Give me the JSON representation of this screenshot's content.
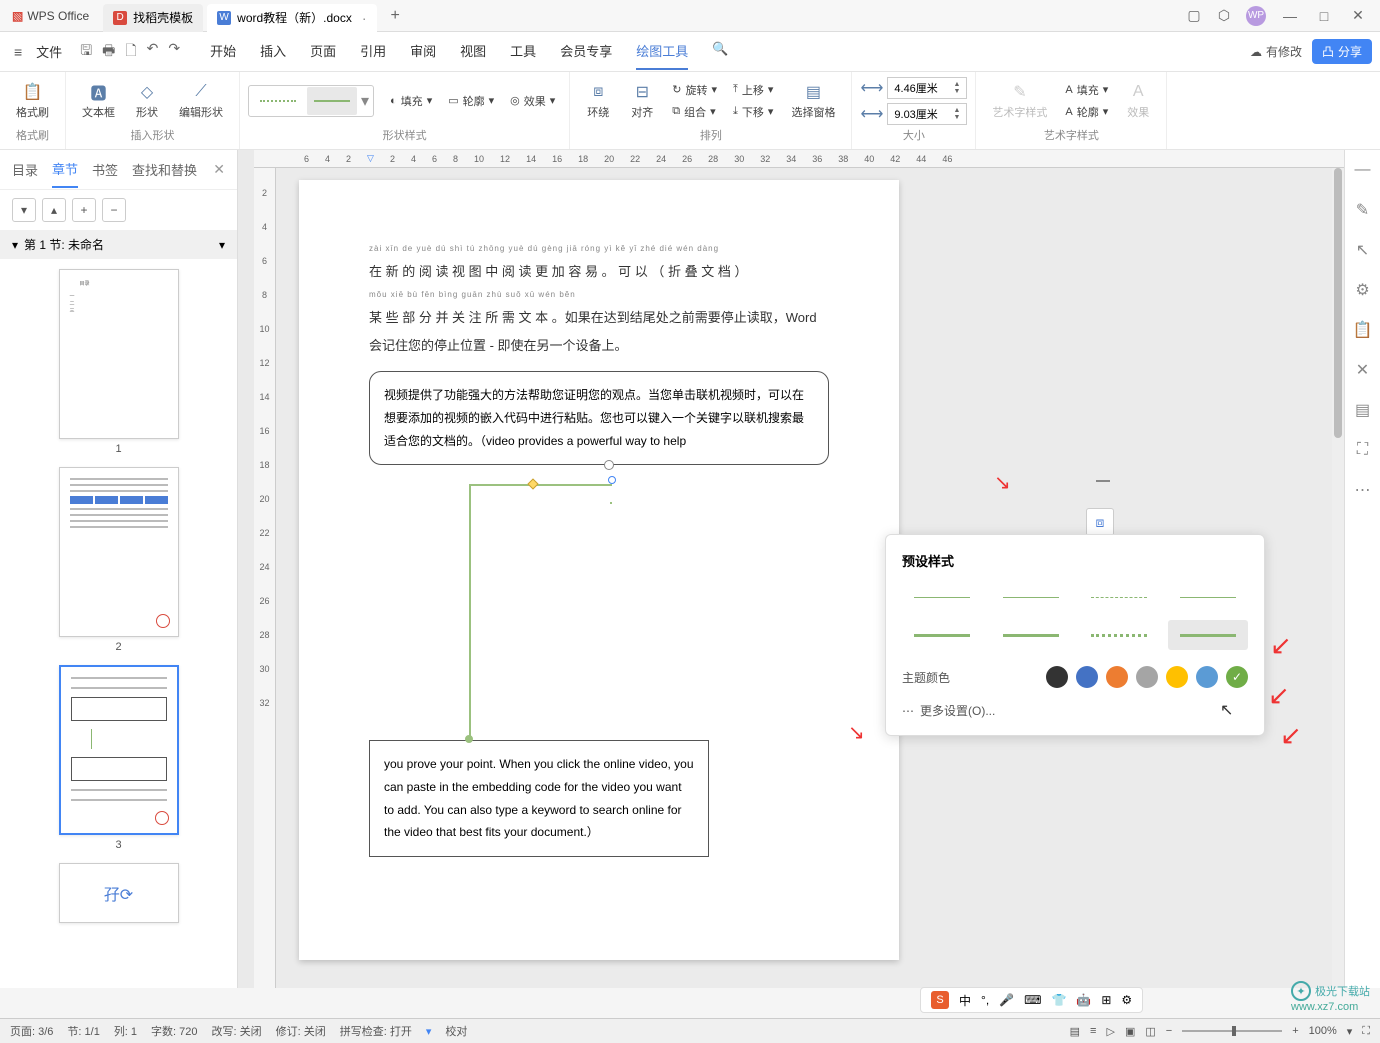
{
  "titlebar": {
    "app_name": "WPS Office",
    "tabs": [
      {
        "icon": "D",
        "label": "找稻壳模板"
      },
      {
        "icon": "W",
        "label": "word教程（新）.docx"
      }
    ],
    "avatar": "WP"
  },
  "menubar": {
    "file": "文件",
    "tabs": [
      "开始",
      "插入",
      "页面",
      "引用",
      "审阅",
      "视图",
      "工具",
      "会员专享",
      "绘图工具"
    ],
    "active": "绘图工具",
    "edit_status": "有修改",
    "share": "分享"
  },
  "ribbon": {
    "format_painter": "格式刷",
    "group_format": "格式刷",
    "textbox": "文本框",
    "shape": "形状",
    "edit_shape": "编辑形状",
    "group_insert": "插入形状",
    "fill": "填充",
    "outline": "轮廓",
    "effect": "效果",
    "group_style": "形状样式",
    "wrap": "环绕",
    "align": "对齐",
    "rotate": "旋转",
    "group": "组合",
    "move_up": "上移",
    "move_down": "下移",
    "select_pane": "选择窗格",
    "group_arrange": "排列",
    "width": "4.46厘米",
    "height": "9.03厘米",
    "group_size": "大小",
    "art_style": "艺术字样式",
    "art_fill": "填充",
    "art_outline": "轮廓",
    "art_effect": "效果",
    "group_art": "艺术字样式"
  },
  "left_panel": {
    "tabs": [
      "目录",
      "章节",
      "书签",
      "查找和替换"
    ],
    "active": "章节",
    "section": "第 1 节: 未命名",
    "thumb_labels": [
      "1",
      "2",
      "3"
    ]
  },
  "ruler_h": [
    "6",
    "4",
    "2",
    "",
    "2",
    "4",
    "6",
    "8",
    "10",
    "12",
    "14",
    "16",
    "18",
    "20",
    "22",
    "24",
    "26",
    "28",
    "30",
    "32",
    "34",
    "36",
    "38",
    "40",
    "42",
    "44",
    "46"
  ],
  "ruler_v": [
    "2",
    "4",
    "6",
    "8",
    "10",
    "12",
    "14",
    "16",
    "18",
    "20",
    "22",
    "24",
    "26",
    "28",
    "30",
    "32"
  ],
  "doc": {
    "pinyin": "zài xīn de yuè dú shì tú zhōng yuè dú gèng jiā róng yì     kě yǐ     zhé dié wén dàng",
    "line1": "在 新 的 阅 读 视 图 中 阅 读 更 加 容 易 。 可 以 （ 折 叠 文 档 ）",
    "pinyin2": "mǒu xiē bù fēn bìng guān zhù suǒ xū wén běn",
    "line2": "某 些 部 分 并 关 注 所 需 文 本 。如果在达到结尾处之前需要停止读取，Word",
    "line3": "会记住您的停止位置 - 即使在另一个设备上。",
    "box1": "视频提供了功能强大的方法帮助您证明您的观点。当您单击联机视频时，可以在想要添加的视频的嵌入代码中进行粘贴。您也可以键入一个关键字以联机搜索最适合您的文档的。（video provides a powerful way to help",
    "box2": "you prove your point. When you click the online video, you can paste in the embedding code for the video you want to add. You can also type a keyword to search online for the video that best fits your document.）"
  },
  "popup": {
    "title": "预设样式",
    "color_label": "主题颜色",
    "colors": [
      "#333333",
      "#4472c4",
      "#ed7d31",
      "#a5a5a5",
      "#ffc000",
      "#5b9bd5",
      "#70ad47"
    ],
    "selected_color": 6,
    "more": "更多设置(O)..."
  },
  "statusbar": {
    "page": "页面: 3/6",
    "section": "节: 1/1",
    "col": "列: 1",
    "words": "字数: 720",
    "revision": "改写: 关闭",
    "track": "修订: 关闭",
    "spell": "拼写检查: 打开",
    "proof": "校对",
    "zoom": "100%"
  },
  "ime": {
    "label": "中"
  },
  "watermark": {
    "site": "极光下载站",
    "url": "www.xz7.com"
  }
}
